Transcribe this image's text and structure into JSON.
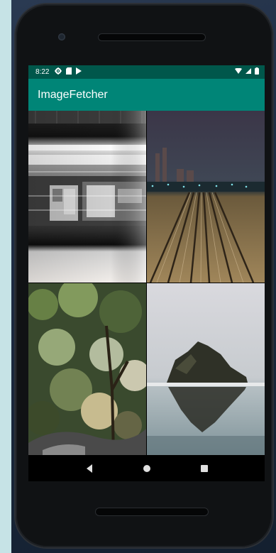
{
  "status_bar": {
    "time": "8:22",
    "left_icons": [
      "settings-icon",
      "sd-card-icon",
      "play-store-icon"
    ],
    "right_icons": [
      "wifi-icon",
      "signal-icon",
      "battery-icon"
    ]
  },
  "app_bar": {
    "title": "ImageFetcher"
  },
  "colors": {
    "status_bar": "#00574b",
    "app_bar": "#008577",
    "backdrop": "#c6e3e6"
  },
  "images": [
    {
      "subject": "blurred subway train"
    },
    {
      "subject": "railway tracks at night"
    },
    {
      "subject": "bokeh tree foliage"
    },
    {
      "subject": "sea rock reflection"
    }
  ],
  "nav_bar": {
    "icons": [
      "back-icon",
      "home-icon",
      "recents-icon"
    ]
  }
}
